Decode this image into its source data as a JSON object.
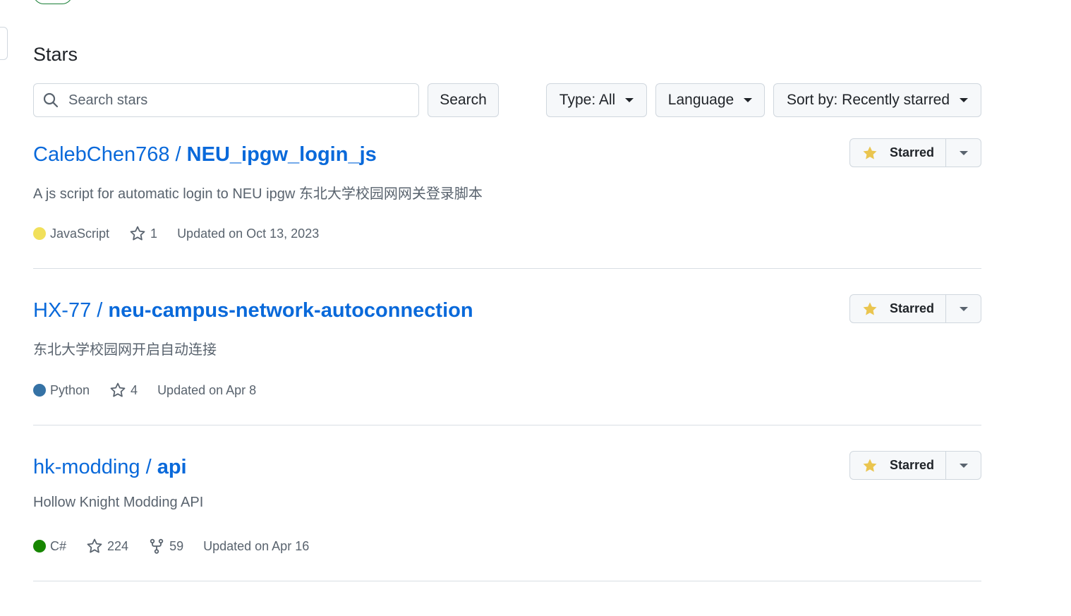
{
  "page": {
    "title": "Stars"
  },
  "search": {
    "placeholder": "Search stars",
    "value": "",
    "button_label": "Search"
  },
  "filters": {
    "type_label": "Type: All",
    "language_label": "Language",
    "sort_label": "Sort by: Recently starred"
  },
  "colors": {
    "link": "#0969da",
    "star_fill": "#eac54f",
    "javascript": "#f1e05a",
    "python": "#3572A5",
    "csharp": "#178600"
  },
  "repos": [
    {
      "owner": "CalebChen768",
      "separator": " / ",
      "name": "NEU_ipgw_login_js",
      "description": "A js script for automatic login to NEU ipgw 东北大学校园网网关登录脚本",
      "language": "JavaScript",
      "language_color": "#f1e05a",
      "stars": "1",
      "forks": "",
      "updated": "Updated on Oct 13, 2023",
      "star_button_label": "Starred"
    },
    {
      "owner": "HX-77",
      "separator": " / ",
      "name": "neu-campus-network-autoconnection",
      "description": "东北大学校园网开启自动连接",
      "language": "Python",
      "language_color": "#3572A5",
      "stars": "4",
      "forks": "",
      "updated": "Updated on Apr 8",
      "star_button_label": "Starred"
    },
    {
      "owner": "hk-modding",
      "separator": " / ",
      "name": "api",
      "description": "Hollow Knight Modding API",
      "language": "C#",
      "language_color": "#178600",
      "stars": "224",
      "forks": "59",
      "updated": "Updated on Apr 16",
      "star_button_label": "Starred"
    }
  ]
}
